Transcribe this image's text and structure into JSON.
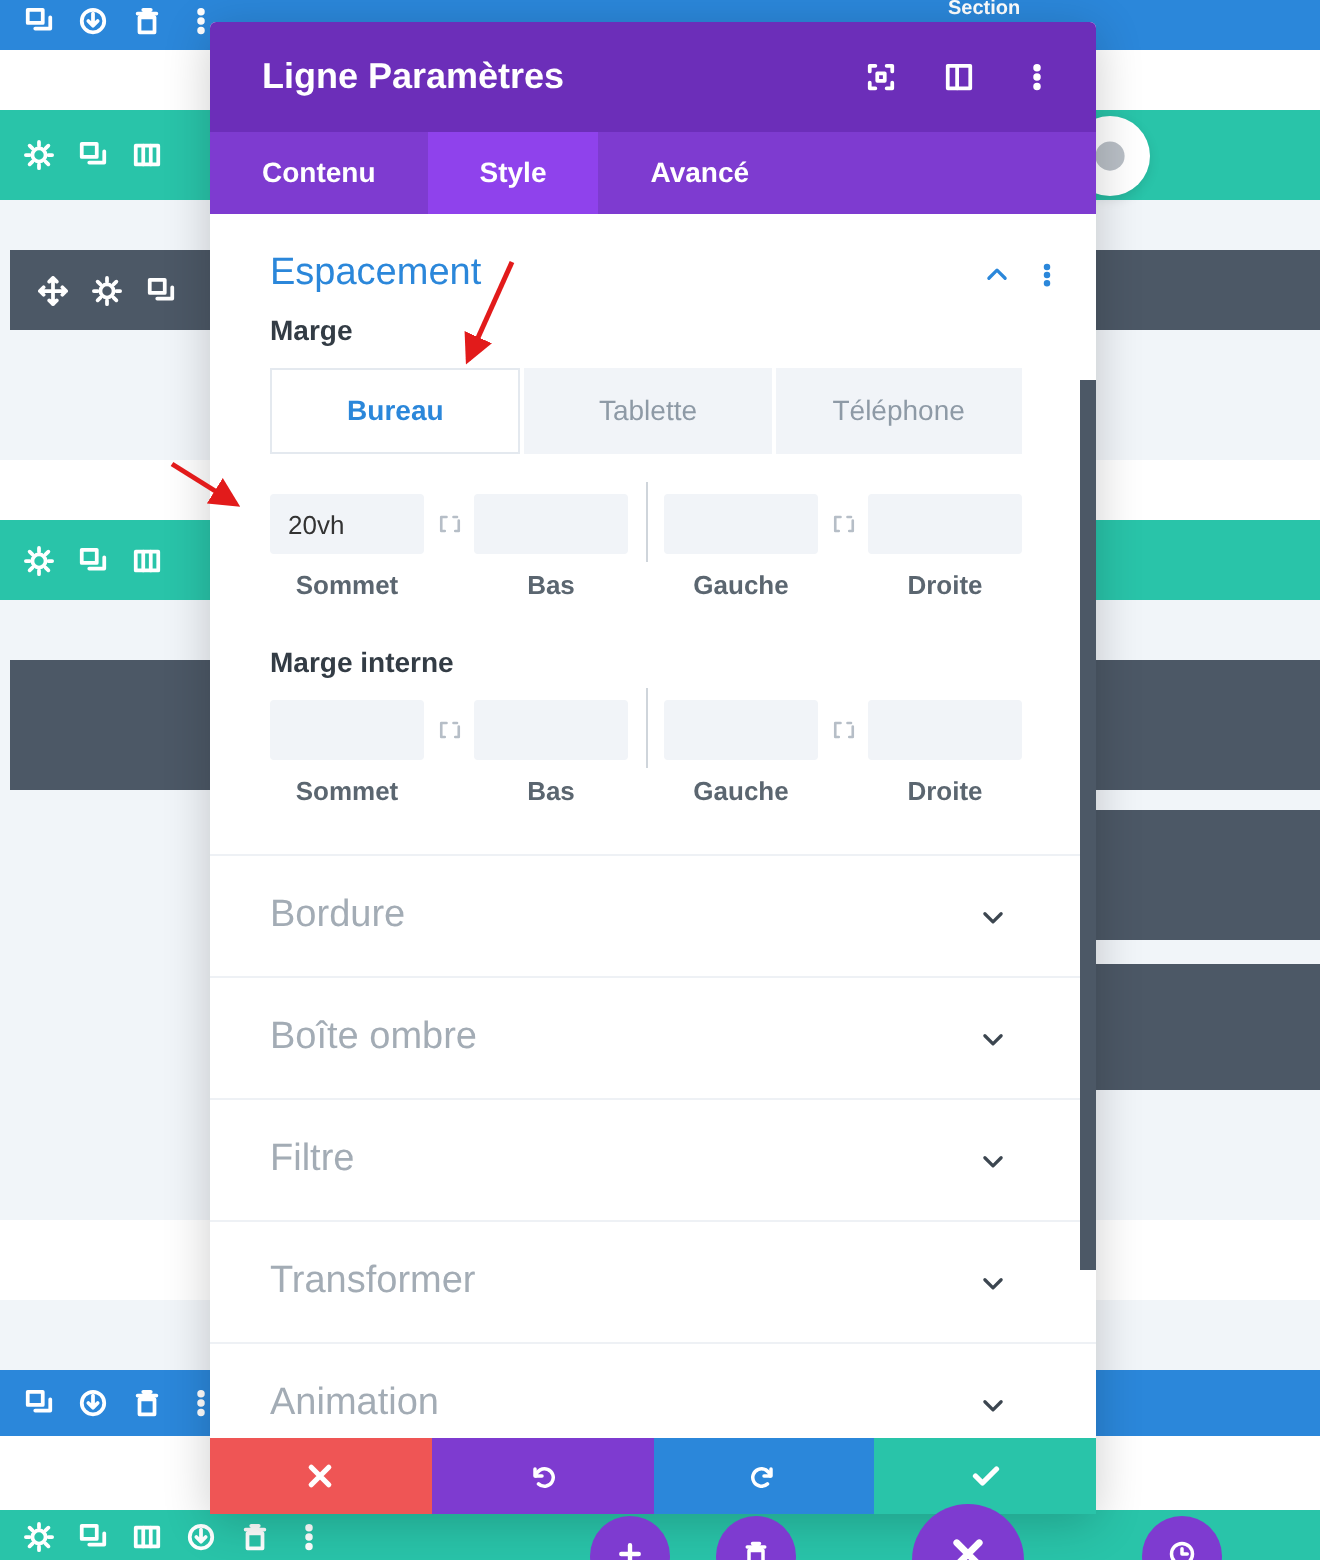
{
  "builder": {
    "bars": [
      {
        "kind": "section",
        "label": "Section"
      },
      {
        "kind": "row"
      },
      {
        "kind": "module"
      },
      {
        "kind": "row"
      },
      {
        "kind": "section"
      },
      {
        "kind": "row"
      }
    ]
  },
  "modal": {
    "title": "Ligne Paramètres",
    "tabs": [
      {
        "label": "Contenu",
        "selected": false
      },
      {
        "label": "Style",
        "selected": true
      },
      {
        "label": "Avancé",
        "selected": false
      }
    ],
    "sections": [
      {
        "title": "Espacement",
        "expanded": true,
        "groups": [
          {
            "label": "Marge",
            "devices": [
              {
                "label": "Bureau",
                "selected": true
              },
              {
                "label": "Tablette",
                "selected": false
              },
              {
                "label": "Téléphone",
                "selected": false
              }
            ],
            "fields": [
              {
                "label": "Sommet",
                "value": "20vh"
              },
              {
                "label": "Bas"
              },
              {
                "label": "Gauche"
              },
              {
                "label": "Droite"
              }
            ]
          },
          {
            "label": "Marge interne",
            "fields": [
              {
                "label": "Sommet"
              },
              {
                "label": "Bas"
              },
              {
                "label": "Gauche"
              },
              {
                "label": "Droite"
              }
            ]
          }
        ]
      },
      {
        "title": "Bordure",
        "expanded": false
      },
      {
        "title": "Boîte ombre",
        "expanded": false
      },
      {
        "title": "Filtre",
        "expanded": false
      },
      {
        "title": "Transformer",
        "expanded": false
      },
      {
        "title": "Animation",
        "expanded": false
      }
    ],
    "footer_buttons": [
      {
        "kind": "cancel"
      },
      {
        "kind": "undo"
      },
      {
        "kind": "redo"
      },
      {
        "kind": "save"
      }
    ]
  },
  "floating_buttons": [
    {
      "kind": "add"
    },
    {
      "kind": "trash"
    },
    {
      "kind": "close"
    },
    {
      "kind": "history"
    }
  ]
}
